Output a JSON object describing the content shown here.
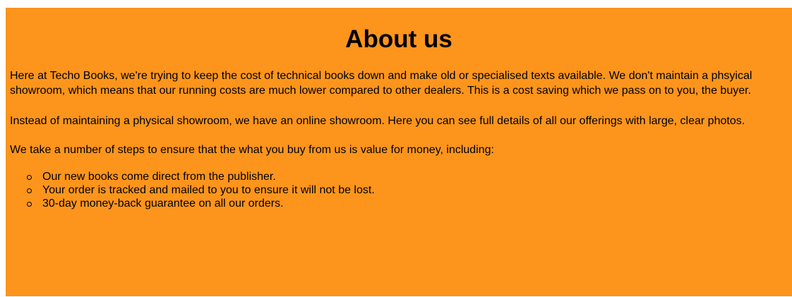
{
  "about": {
    "title": "About us",
    "paragraphs": [
      "Here at Techo Books, we're trying to keep the cost of technical books down and make old or specialised texts available. We don't maintain a phsyical showroom, which means that our running costs are much lower compared to other dealers. This is a cost saving which we pass on to you, the buyer.",
      "Instead of maintaining a physical showroom, we have an online showroom. Here you can see full details of all our offerings with large, clear photos.",
      "We take a number of steps to ensure that the what you buy from us is value for money, including:"
    ],
    "list_items": [
      "Our new books come direct from the publisher.",
      "Your order is tracked and mailed to you to ensure it will not be lost.",
      "30-day money-back guarantee on all our orders."
    ],
    "list_bullet_icon": "hollow-circle-bullet",
    "background_color": "#fd951c"
  }
}
